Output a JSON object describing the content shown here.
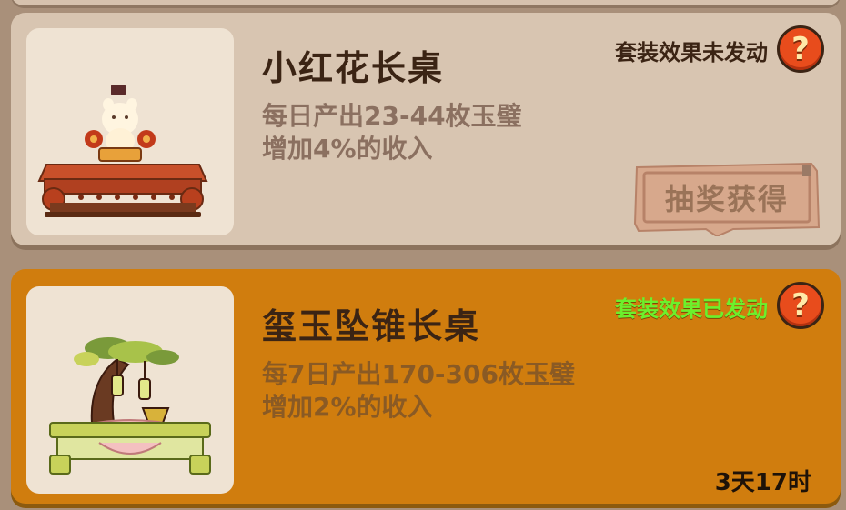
{
  "items": [
    {
      "name": "小红花长桌",
      "desc_line1": "每日产出23-44枚玉璧",
      "desc_line2": "增加4%的收入",
      "set_status": "套装效果未发动",
      "action_label": "抽奖获得",
      "help_glyph": "?",
      "status_color": "#3b2414"
    },
    {
      "name": "玺玉坠锥长桌",
      "desc_line1": "每7日产出170-306枚玉璧",
      "desc_line2": "增加2%的收入",
      "set_status": "套装效果已发动",
      "timer": "3天17时",
      "help_glyph": "?",
      "status_color": "#6cf02c"
    }
  ],
  "icons": {
    "help": "question-mark-icon",
    "item1": "red-flower-table-icon",
    "item2": "jade-pendant-table-icon"
  },
  "colors": {
    "card_inactive": "#d8c5b1",
    "card_active": "#d07d0e",
    "help_button": "#e84c1c"
  }
}
